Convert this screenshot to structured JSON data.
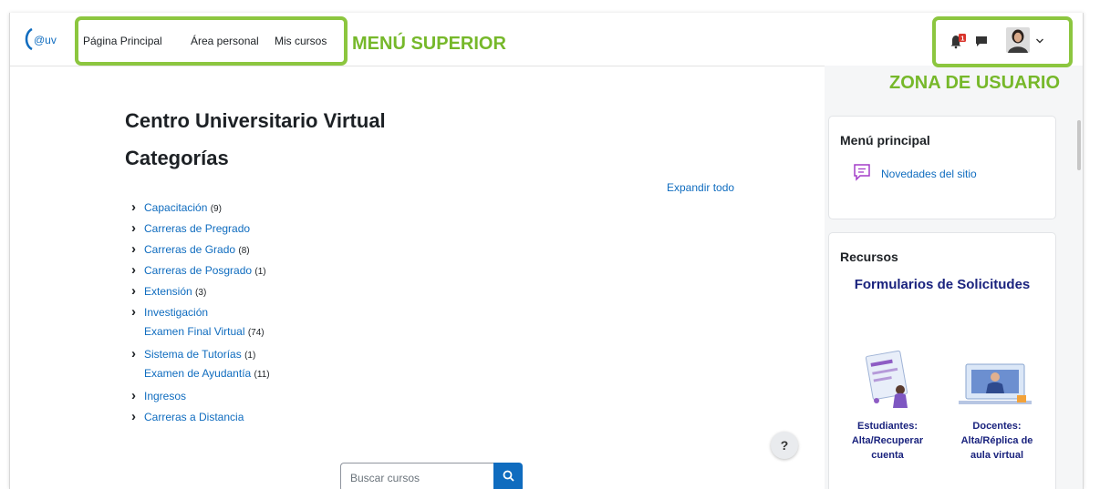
{
  "brand": {
    "logo_text": "@uv"
  },
  "nav": {
    "items": [
      "Página Principal",
      "Área personal",
      "Mis cursos"
    ],
    "notif_count": "1"
  },
  "annotations": {
    "menu_label": "MENÚ SUPERIOR",
    "user_label": "ZONA DE USUARIO"
  },
  "main": {
    "site_title": "Centro Universitario Virtual",
    "categories_heading": "Categorías",
    "expand_all": "Expandir todo",
    "categories": [
      {
        "name": "Capacitación",
        "count": "(9)",
        "expandable": true
      },
      {
        "name": "Carreras de Pregrado",
        "count": "",
        "expandable": true
      },
      {
        "name": "Carreras de Grado",
        "count": "(8)",
        "expandable": true
      },
      {
        "name": "Carreras de Posgrado",
        "count": "(1)",
        "expandable": true
      },
      {
        "name": "Extensión",
        "count": "(3)",
        "expandable": true
      },
      {
        "name": "Investigación",
        "count": "",
        "expandable": true
      },
      {
        "name": "Examen Final Virtual",
        "count": "(74)",
        "expandable": false
      },
      {
        "name": "Sistema de Tutorías",
        "count": "(1)",
        "expandable": true
      },
      {
        "name": "Examen de Ayudantía",
        "count": "(11)",
        "expandable": false
      },
      {
        "name": "Ingresos",
        "count": "",
        "expandable": true
      },
      {
        "name": "Carreras a Distancia",
        "count": "",
        "expandable": true
      }
    ],
    "search_placeholder": "Buscar cursos",
    "help_symbol": "?"
  },
  "sidebar": {
    "main_menu": {
      "title": "Menú principal",
      "item": "Novedades del sitio"
    },
    "resources": {
      "title": "Recursos",
      "subtitle": "Formularios de Solicitudes",
      "students": [
        "Estudiantes:",
        "Alta/Recuperar",
        "cuenta"
      ],
      "teachers": [
        "Docentes:",
        "Alta/Réplica de",
        "aula virtual"
      ]
    }
  },
  "colors": {
    "link": "#0f6cbf",
    "annotation": "#8cc63f",
    "heading_blue": "#1a237e"
  }
}
